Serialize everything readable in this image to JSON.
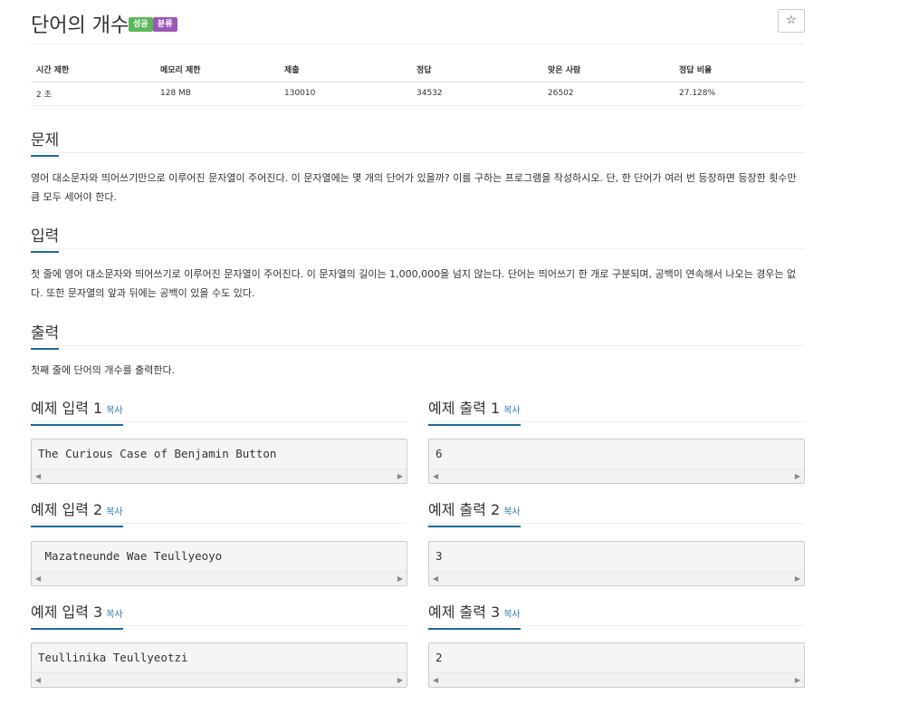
{
  "problem": {
    "title": "단어의 개수",
    "labels": {
      "success": "성공",
      "category": "분류"
    },
    "star_icon": "☆"
  },
  "info": {
    "headers": [
      "시간 제한",
      "메모리 제한",
      "제출",
      "정답",
      "맞은 사람",
      "정답 비율"
    ],
    "values": [
      "2 초",
      "128 MB",
      "130010",
      "34532",
      "26502",
      "27.128%"
    ]
  },
  "sections": {
    "description": {
      "heading": "문제",
      "text": "영어 대소문자와 띄어쓰기만으로 이루어진 문자열이 주어진다. 이 문자열에는 몇 개의 단어가 있을까? 이를 구하는 프로그램을 작성하시오. 단, 한 단어가 여러 번 등장하면 등장한 횟수만큼 모두 세어야 한다."
    },
    "input": {
      "heading": "입력",
      "text": "첫 줄에 영어 대소문자와 띄어쓰기로 이루어진 문자열이 주어진다. 이 문자열의 길이는 1,000,000을 넘지 않는다. 단어는 띄어쓰기 한 개로 구분되며, 공백이 연속해서 나오는 경우는 없다. 또한 문자열의 앞과 뒤에는 공백이 있을 수도 있다."
    },
    "output": {
      "heading": "출력",
      "text": "첫째 줄에 단어의 개수를 출력한다."
    }
  },
  "samples": {
    "copy_label": "복사",
    "items": [
      {
        "input_title": "예제 입력 1",
        "input": "The Curious Case of Benjamin Button",
        "output_title": "예제 출력 1",
        "output": "6"
      },
      {
        "input_title": "예제 입력 2",
        "input": " Mazatneunde Wae Teullyeoyo",
        "output_title": "예제 출력 2",
        "output": "3"
      },
      {
        "input_title": "예제 입력 3",
        "input": "Teullinika Teullyeotzi",
        "output_title": "예제 출력 3",
        "output": "2"
      }
    ]
  }
}
